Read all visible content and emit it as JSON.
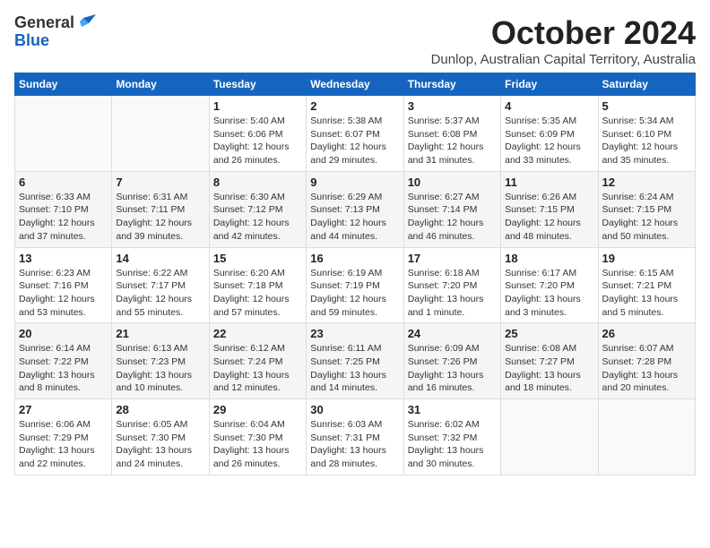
{
  "header": {
    "logo_general": "General",
    "logo_blue": "Blue",
    "title": "October 2024",
    "location": "Dunlop, Australian Capital Territory, Australia"
  },
  "days_of_week": [
    "Sunday",
    "Monday",
    "Tuesday",
    "Wednesday",
    "Thursday",
    "Friday",
    "Saturday"
  ],
  "weeks": [
    [
      {
        "day": "",
        "info": ""
      },
      {
        "day": "",
        "info": ""
      },
      {
        "day": "1",
        "info": "Sunrise: 5:40 AM\nSunset: 6:06 PM\nDaylight: 12 hours\nand 26 minutes."
      },
      {
        "day": "2",
        "info": "Sunrise: 5:38 AM\nSunset: 6:07 PM\nDaylight: 12 hours\nand 29 minutes."
      },
      {
        "day": "3",
        "info": "Sunrise: 5:37 AM\nSunset: 6:08 PM\nDaylight: 12 hours\nand 31 minutes."
      },
      {
        "day": "4",
        "info": "Sunrise: 5:35 AM\nSunset: 6:09 PM\nDaylight: 12 hours\nand 33 minutes."
      },
      {
        "day": "5",
        "info": "Sunrise: 5:34 AM\nSunset: 6:10 PM\nDaylight: 12 hours\nand 35 minutes."
      }
    ],
    [
      {
        "day": "6",
        "info": "Sunrise: 6:33 AM\nSunset: 7:10 PM\nDaylight: 12 hours\nand 37 minutes."
      },
      {
        "day": "7",
        "info": "Sunrise: 6:31 AM\nSunset: 7:11 PM\nDaylight: 12 hours\nand 39 minutes."
      },
      {
        "day": "8",
        "info": "Sunrise: 6:30 AM\nSunset: 7:12 PM\nDaylight: 12 hours\nand 42 minutes."
      },
      {
        "day": "9",
        "info": "Sunrise: 6:29 AM\nSunset: 7:13 PM\nDaylight: 12 hours\nand 44 minutes."
      },
      {
        "day": "10",
        "info": "Sunrise: 6:27 AM\nSunset: 7:14 PM\nDaylight: 12 hours\nand 46 minutes."
      },
      {
        "day": "11",
        "info": "Sunrise: 6:26 AM\nSunset: 7:15 PM\nDaylight: 12 hours\nand 48 minutes."
      },
      {
        "day": "12",
        "info": "Sunrise: 6:24 AM\nSunset: 7:15 PM\nDaylight: 12 hours\nand 50 minutes."
      }
    ],
    [
      {
        "day": "13",
        "info": "Sunrise: 6:23 AM\nSunset: 7:16 PM\nDaylight: 12 hours\nand 53 minutes."
      },
      {
        "day": "14",
        "info": "Sunrise: 6:22 AM\nSunset: 7:17 PM\nDaylight: 12 hours\nand 55 minutes."
      },
      {
        "day": "15",
        "info": "Sunrise: 6:20 AM\nSunset: 7:18 PM\nDaylight: 12 hours\nand 57 minutes."
      },
      {
        "day": "16",
        "info": "Sunrise: 6:19 AM\nSunset: 7:19 PM\nDaylight: 12 hours\nand 59 minutes."
      },
      {
        "day": "17",
        "info": "Sunrise: 6:18 AM\nSunset: 7:20 PM\nDaylight: 13 hours\nand 1 minute."
      },
      {
        "day": "18",
        "info": "Sunrise: 6:17 AM\nSunset: 7:20 PM\nDaylight: 13 hours\nand 3 minutes."
      },
      {
        "day": "19",
        "info": "Sunrise: 6:15 AM\nSunset: 7:21 PM\nDaylight: 13 hours\nand 5 minutes."
      }
    ],
    [
      {
        "day": "20",
        "info": "Sunrise: 6:14 AM\nSunset: 7:22 PM\nDaylight: 13 hours\nand 8 minutes."
      },
      {
        "day": "21",
        "info": "Sunrise: 6:13 AM\nSunset: 7:23 PM\nDaylight: 13 hours\nand 10 minutes."
      },
      {
        "day": "22",
        "info": "Sunrise: 6:12 AM\nSunset: 7:24 PM\nDaylight: 13 hours\nand 12 minutes."
      },
      {
        "day": "23",
        "info": "Sunrise: 6:11 AM\nSunset: 7:25 PM\nDaylight: 13 hours\nand 14 minutes."
      },
      {
        "day": "24",
        "info": "Sunrise: 6:09 AM\nSunset: 7:26 PM\nDaylight: 13 hours\nand 16 minutes."
      },
      {
        "day": "25",
        "info": "Sunrise: 6:08 AM\nSunset: 7:27 PM\nDaylight: 13 hours\nand 18 minutes."
      },
      {
        "day": "26",
        "info": "Sunrise: 6:07 AM\nSunset: 7:28 PM\nDaylight: 13 hours\nand 20 minutes."
      }
    ],
    [
      {
        "day": "27",
        "info": "Sunrise: 6:06 AM\nSunset: 7:29 PM\nDaylight: 13 hours\nand 22 minutes."
      },
      {
        "day": "28",
        "info": "Sunrise: 6:05 AM\nSunset: 7:30 PM\nDaylight: 13 hours\nand 24 minutes."
      },
      {
        "day": "29",
        "info": "Sunrise: 6:04 AM\nSunset: 7:30 PM\nDaylight: 13 hours\nand 26 minutes."
      },
      {
        "day": "30",
        "info": "Sunrise: 6:03 AM\nSunset: 7:31 PM\nDaylight: 13 hours\nand 28 minutes."
      },
      {
        "day": "31",
        "info": "Sunrise: 6:02 AM\nSunset: 7:32 PM\nDaylight: 13 hours\nand 30 minutes."
      },
      {
        "day": "",
        "info": ""
      },
      {
        "day": "",
        "info": ""
      }
    ]
  ]
}
